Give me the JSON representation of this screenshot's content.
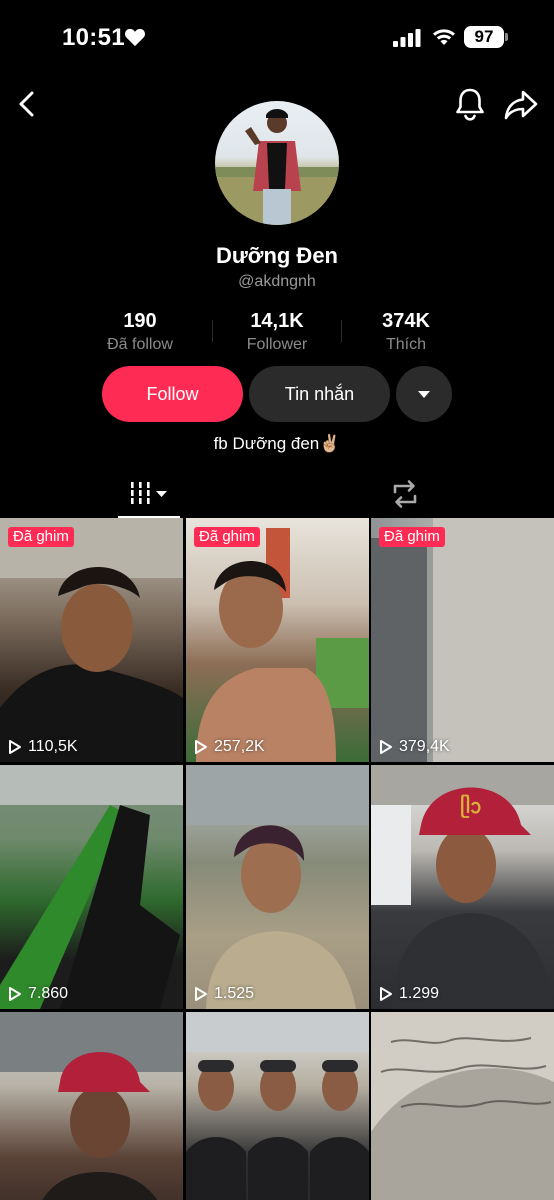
{
  "status_bar": {
    "time": "10:51",
    "battery": "97"
  },
  "profile": {
    "display_name": "Dưỡng Đen",
    "username": "@akdngnh",
    "bio": "fb Dưỡng đen✌🏼"
  },
  "stats": [
    {
      "value": "190",
      "label": "Đã follow"
    },
    {
      "value": "14,1K",
      "label": "Follower"
    },
    {
      "value": "374K",
      "label": "Thích"
    }
  ],
  "actions": {
    "follow": "Follow",
    "message": "Tin nhắn"
  },
  "videos": [
    {
      "pinned": "Đã ghim",
      "views": "110,5K"
    },
    {
      "pinned": "Đã ghim",
      "views": "257,2K"
    },
    {
      "pinned": "Đã ghim",
      "views": "379,4K"
    },
    {
      "views": "7.860"
    },
    {
      "views": "1.525"
    },
    {
      "views": "1.299"
    },
    {
      "views": ""
    },
    {
      "views": ""
    },
    {
      "views": ""
    }
  ],
  "icons": {
    "back": "chevron-left-icon",
    "bell": "bell-icon",
    "share": "share-arrow-icon",
    "videos_tab": "grid-bars-icon",
    "reposts_tab": "repost-icon",
    "play": "play-outline-icon"
  },
  "colors": {
    "accent": "#fe2c55",
    "background": "#000000",
    "secondary_button": "#2b2b2b"
  }
}
